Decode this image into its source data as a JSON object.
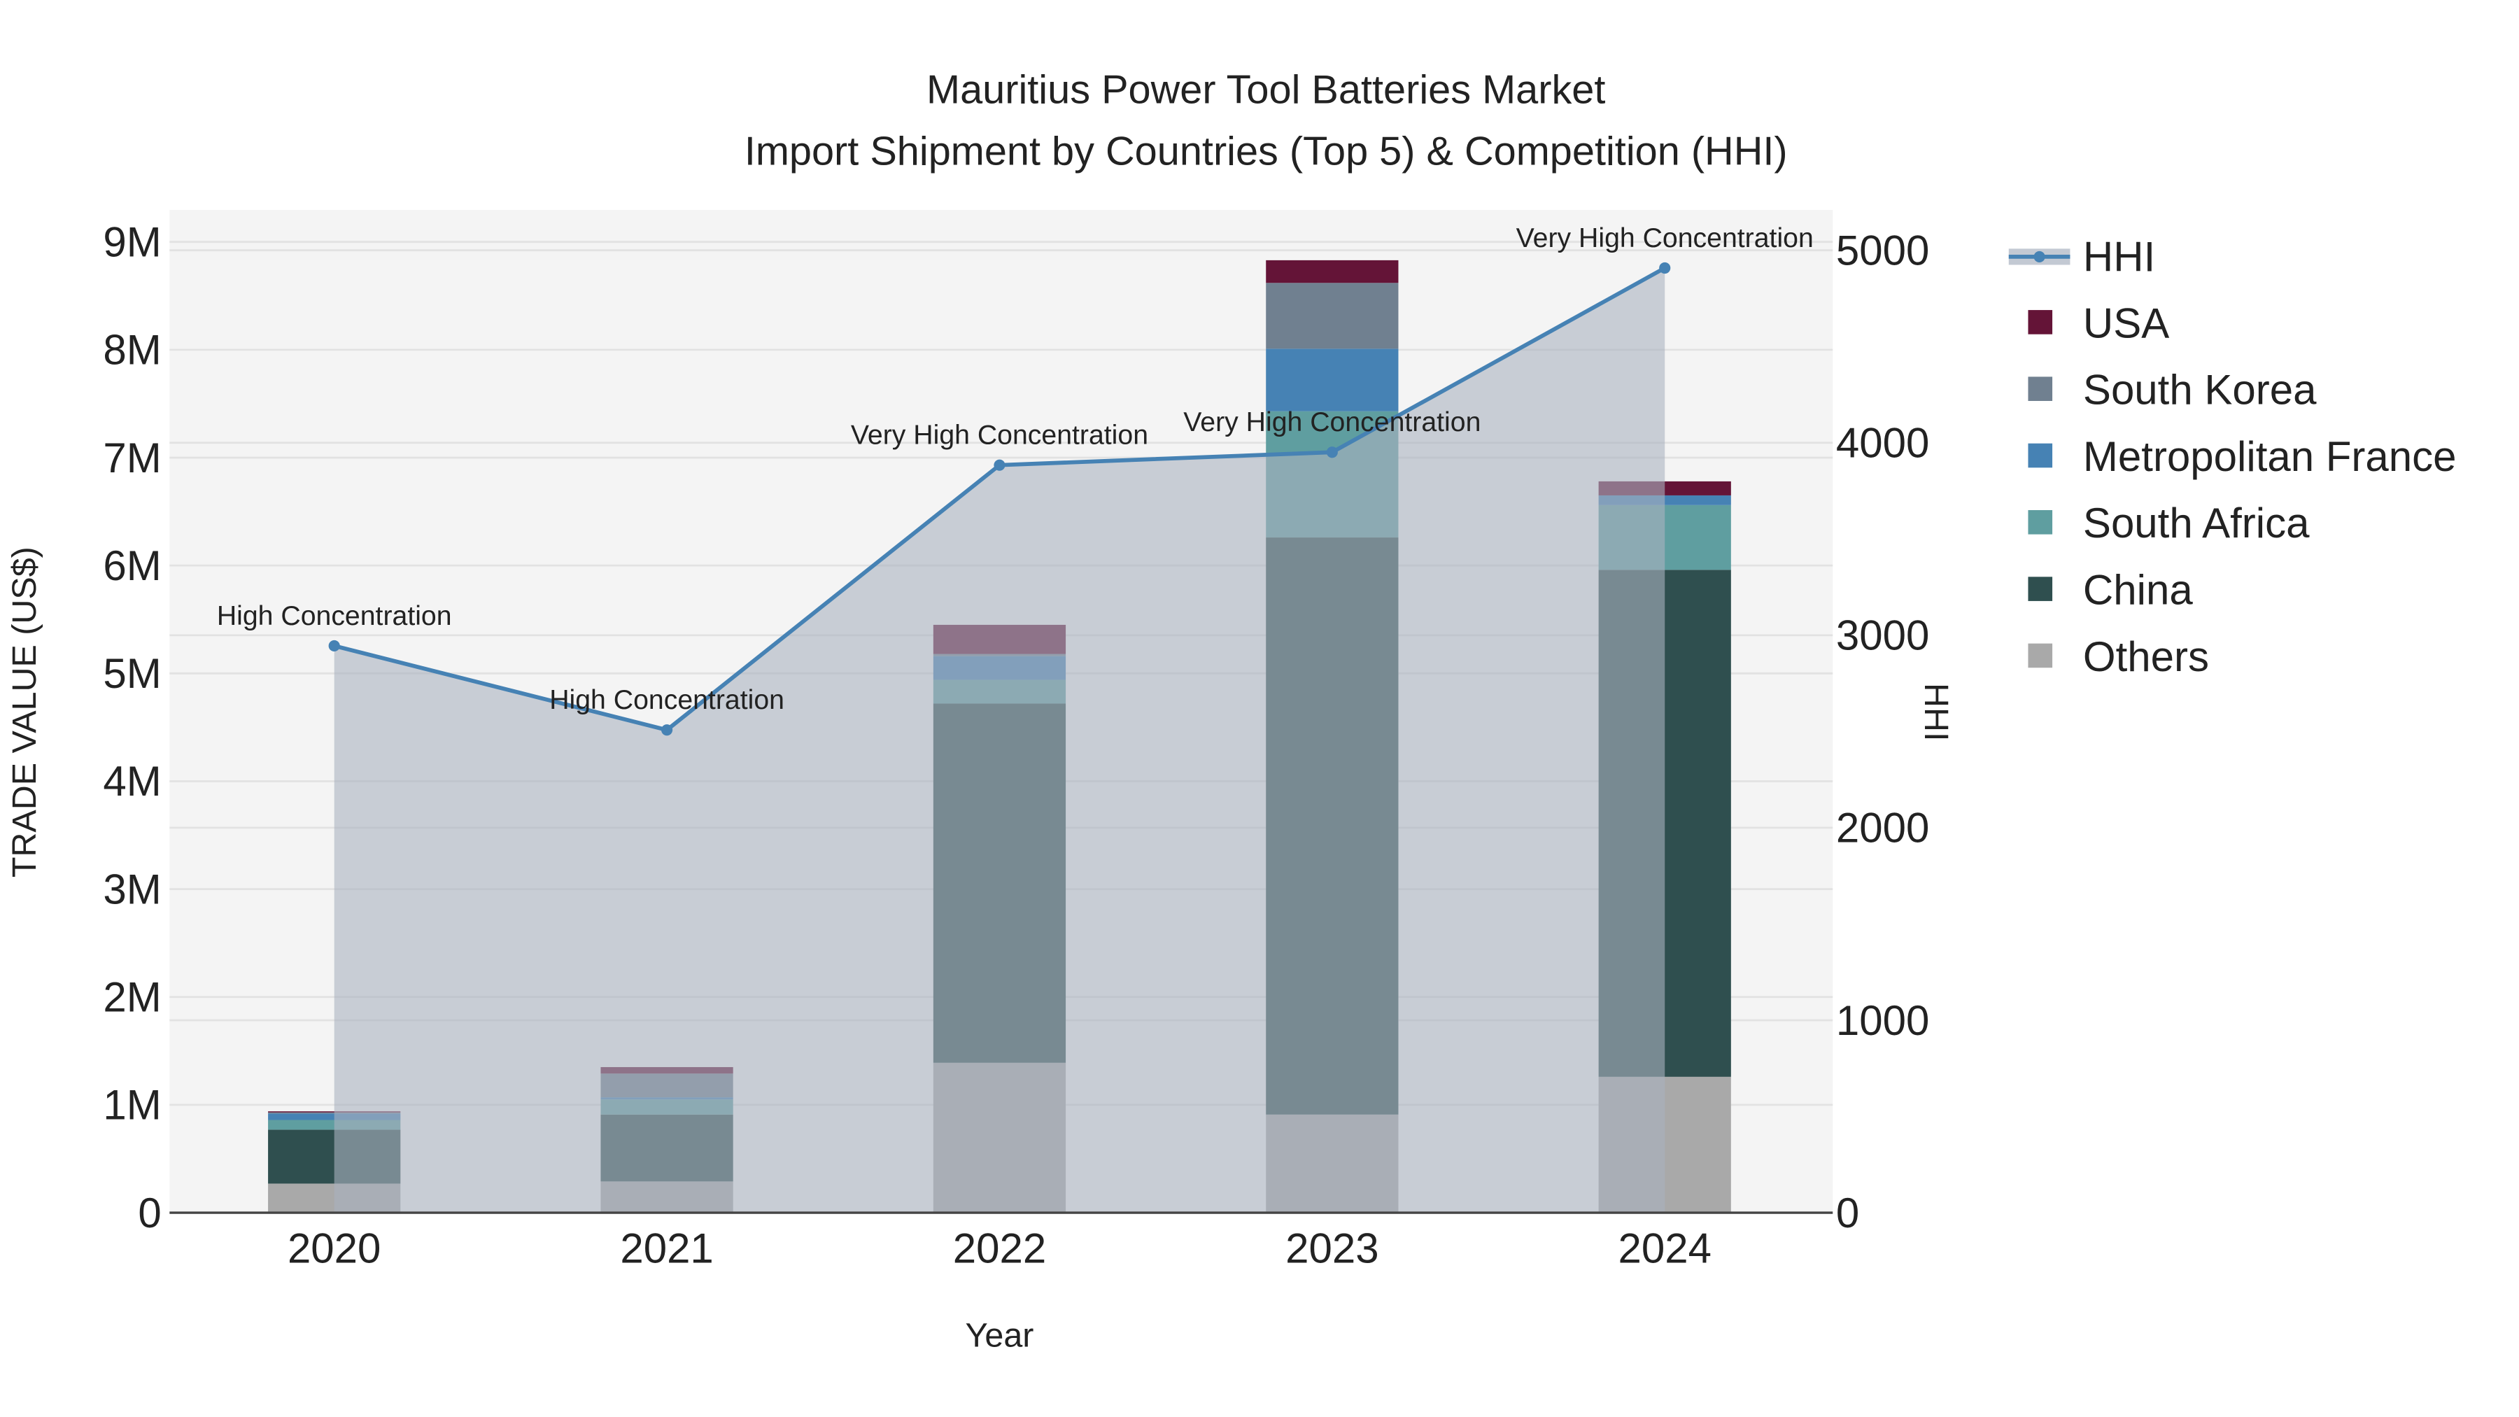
{
  "chart_data": {
    "type": "bar",
    "title": "Mauritius Power Tool Batteries Market",
    "subtitle": "Import Shipment by Countries (Top 5) & Competition (HHI)",
    "xlabel": "Year",
    "ylabel": "TRADE VALUE (US$)",
    "y2label": "HHI",
    "categories": [
      "2020",
      "2021",
      "2022",
      "2023",
      "2024"
    ],
    "ylim": [
      0,
      9300000
    ],
    "y2lim": [
      0,
      5200
    ],
    "yticks": [
      {
        "v": 0,
        "label": "0"
      },
      {
        "v": 1000000,
        "label": "1M"
      },
      {
        "v": 2000000,
        "label": "2M"
      },
      {
        "v": 3000000,
        "label": "3M"
      },
      {
        "v": 4000000,
        "label": "4M"
      },
      {
        "v": 5000000,
        "label": "5M"
      },
      {
        "v": 6000000,
        "label": "6M"
      },
      {
        "v": 7000000,
        "label": "7M"
      },
      {
        "v": 8000000,
        "label": "8M"
      },
      {
        "v": 9000000,
        "label": "9M"
      }
    ],
    "y2ticks": [
      {
        "v": 0,
        "label": "0"
      },
      {
        "v": 1000,
        "label": "1000"
      },
      {
        "v": 2000,
        "label": "2000"
      },
      {
        "v": 3000,
        "label": "3000"
      },
      {
        "v": 4000,
        "label": "4000"
      },
      {
        "v": 5000,
        "label": "5000"
      }
    ],
    "grid": true,
    "legend_placement": "right",
    "series": [
      {
        "name": "Others",
        "color": "#a9a9a9",
        "values": [
          270000,
          290000,
          1390000,
          910000,
          1260000
        ]
      },
      {
        "name": "China",
        "color": "#2f4f4f",
        "values": [
          500000,
          620000,
          3330000,
          5350000,
          4700000
        ]
      },
      {
        "name": "South Africa",
        "color": "#5f9ea0",
        "values": [
          90000,
          140000,
          220000,
          1170000,
          600000
        ]
      },
      {
        "name": "Metropolitan France",
        "color": "#4682b4",
        "values": [
          60000,
          20000,
          220000,
          580000,
          90000
        ]
      },
      {
        "name": "South Korea",
        "color": "#708090",
        "values": [
          10000,
          220000,
          20000,
          610000,
          0
        ]
      },
      {
        "name": "USA",
        "color": "#641437",
        "values": [
          10000,
          60000,
          270000,
          210000,
          130000
        ]
      }
    ],
    "hhi": {
      "name": "HHI",
      "color": "#4682b4",
      "values": [
        2945,
        2508,
        3884,
        3951,
        4908
      ],
      "annotations": [
        "High Concentration",
        "High Concentration",
        "Very High Concentration",
        "Very High Concentration",
        "Very High Concentration"
      ]
    }
  }
}
